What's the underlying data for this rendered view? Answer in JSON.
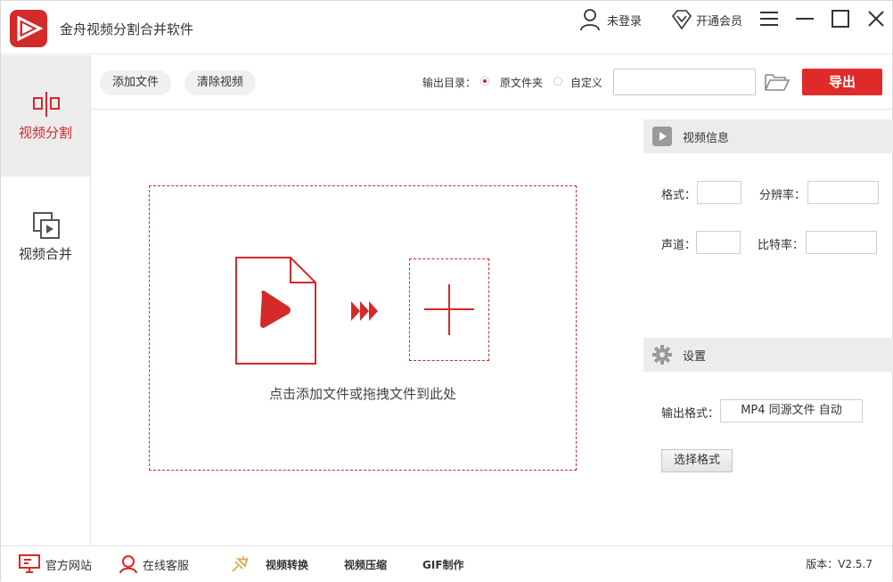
{
  "app": {
    "title": "金舟视频分割合并软件"
  },
  "titlebar": {
    "login_label": "未登录",
    "vip_label": "开通会员",
    "menu_icon": "hamburger-icon",
    "minimize_icon": "minimize-icon",
    "maximize_icon": "maximize-icon",
    "close_icon": "close-icon"
  },
  "sidebar": {
    "items": [
      {
        "label": "视频分割",
        "icon": "split-icon",
        "active": true
      },
      {
        "label": "视频合并",
        "icon": "merge-icon",
        "active": false
      }
    ]
  },
  "toolbar": {
    "add_file": "添加文件",
    "clear_video": "清除视频",
    "output_dir_label": "输出目录：",
    "options": [
      "原文件夹",
      "自定义"
    ],
    "selected_option": "原文件夹",
    "path_value": "",
    "export_label": "导出"
  },
  "dropzone": {
    "hint": "点击添加文件或拖拽文件到此处"
  },
  "video_info": {
    "title": "视频信息",
    "format_label": "格式：",
    "format_value": "",
    "resolution_label": "分辨率：",
    "resolution_value": "",
    "channel_label": "声道：",
    "channel_value": "",
    "bitrate_label": "比特率：",
    "bitrate_value": ""
  },
  "settings": {
    "title": "设置",
    "output_format_label": "输出格式：",
    "output_format_value": "MP4 同源文件 自动",
    "choose_format": "选择格式"
  },
  "footer": {
    "official_site": "官方网站",
    "online_support": "在线客服",
    "links": [
      "视频转换",
      "视频压缩",
      "GIF制作"
    ],
    "version": "版本：V2.5.7"
  },
  "colors": {
    "accent": "#e02a2a",
    "logo": "#d32a2a",
    "panel_head": "#ececec"
  }
}
